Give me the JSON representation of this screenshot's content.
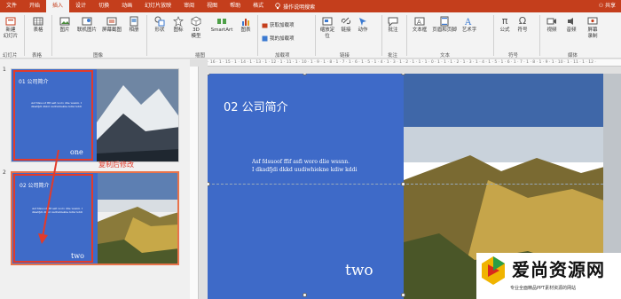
{
  "tabs": {
    "file": "文件",
    "home": "开始",
    "insert": "插入",
    "design": "设计",
    "transitions": "切换",
    "animations": "动画",
    "slideshow": "幻灯片放映",
    "review": "审阅",
    "view": "视图",
    "help": "帮助",
    "format": "格式",
    "tellme": "操作说明搜索",
    "share": "共享"
  },
  "ribbon": {
    "new_slide": "新建\n幻灯片",
    "table": "表格",
    "picture": "图片",
    "online_picture": "联机图片",
    "screenshot": "屏幕截图",
    "album": "相册",
    "shapes": "形状",
    "icons": "图标",
    "model3d": "3D\n模型",
    "smartart": "SmartArt",
    "chart": "图表",
    "get_addins": "获取加载项",
    "my_addins": "我的加载项",
    "zoom": "缩放定\n位",
    "link": "链接",
    "action": "动作",
    "comment": "批注",
    "textbox": "文本框",
    "header_footer": "页眉和页脚",
    "wordart": "艺术字",
    "equation": "公式",
    "symbol": "符号",
    "video": "视频",
    "audio": "音频",
    "screen_record": "屏幕\n录制",
    "groups": {
      "slides": "幻灯片",
      "tables": "表格",
      "images": "图像",
      "illustrations": "插图",
      "addins": "加载项",
      "links": "链接",
      "comments": "批注",
      "text": "文本",
      "symbols": "符号",
      "media": "媒体"
    }
  },
  "thumbnails": [
    {
      "number": "1",
      "title": "01 公司简介",
      "body": "Asf fdsuoof ffif asfi woro dlie wssnn. I dkadfjdi dkkd uudiwhiekne kdiw kddi",
      "word": "one"
    },
    {
      "number": "2",
      "title": "02 公司简介",
      "body": "Asf fdsuoof ffif asfi woro dlie wssnn. I dkadfjdi dkkd uudiwhiekne kdiw kddi",
      "word": "two"
    }
  ],
  "annotation": "复制后修改",
  "slide": {
    "title": "02 公司简介",
    "body_line1": "Asf  fdsuoof  ffif asfi woro dlie wssnn.",
    "body_line2": "I dkadfjdi dkkd uudiwhiekne kdiw kddi",
    "word": "two"
  },
  "ruler_text": "· 16 · 1 · 15 · 1 · 14 · 1 · 13 · 1 · 12 · 1 · 11 · 1 · 10 · 1 · 9 · 1 · 8 · 1 · 7 · 1 · 6 · 1 · 5 · 1 · 4 · 1 · 3 · 1 · 2 · 1 · 1 · 1 · 0 · 1 · 1 · 1 · 2 · 1 · 3 · 1 · 4 · 1 · 5 · 1 · 6 · 1 · 7 · 1 · 8 · 1 · 9 · 1 · 10 · 1 · 11 · 1 · 12 ·",
  "watermark": {
    "title": "爱尚资源网",
    "subtitle": "专业全面精品PPT素材资源的网站"
  },
  "colors": {
    "accent": "#c43e1c",
    "slide_blue": "#3e6ac8",
    "annotation_red": "#e23b2b"
  }
}
